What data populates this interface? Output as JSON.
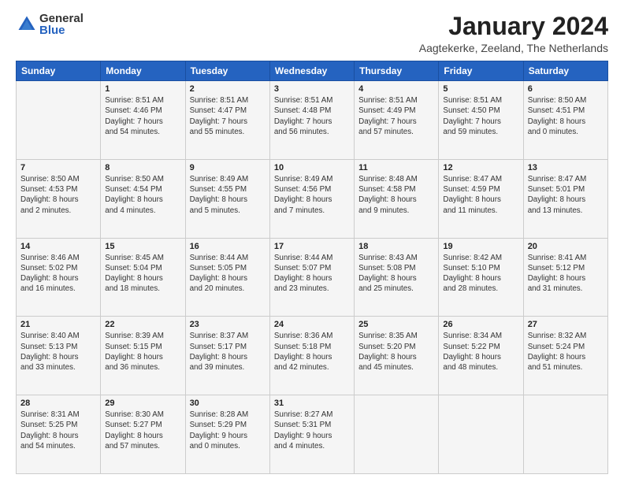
{
  "logo": {
    "general": "General",
    "blue": "Blue"
  },
  "title": "January 2024",
  "location": "Aagtekerke, Zeeland, The Netherlands",
  "weekdays": [
    "Sunday",
    "Monday",
    "Tuesday",
    "Wednesday",
    "Thursday",
    "Friday",
    "Saturday"
  ],
  "weeks": [
    [
      {
        "day": "",
        "info": ""
      },
      {
        "day": "1",
        "info": "Sunrise: 8:51 AM\nSunset: 4:46 PM\nDaylight: 7 hours\nand 54 minutes."
      },
      {
        "day": "2",
        "info": "Sunrise: 8:51 AM\nSunset: 4:47 PM\nDaylight: 7 hours\nand 55 minutes."
      },
      {
        "day": "3",
        "info": "Sunrise: 8:51 AM\nSunset: 4:48 PM\nDaylight: 7 hours\nand 56 minutes."
      },
      {
        "day": "4",
        "info": "Sunrise: 8:51 AM\nSunset: 4:49 PM\nDaylight: 7 hours\nand 57 minutes."
      },
      {
        "day": "5",
        "info": "Sunrise: 8:51 AM\nSunset: 4:50 PM\nDaylight: 7 hours\nand 59 minutes."
      },
      {
        "day": "6",
        "info": "Sunrise: 8:50 AM\nSunset: 4:51 PM\nDaylight: 8 hours\nand 0 minutes."
      }
    ],
    [
      {
        "day": "7",
        "info": "Sunrise: 8:50 AM\nSunset: 4:53 PM\nDaylight: 8 hours\nand 2 minutes."
      },
      {
        "day": "8",
        "info": "Sunrise: 8:50 AM\nSunset: 4:54 PM\nDaylight: 8 hours\nand 4 minutes."
      },
      {
        "day": "9",
        "info": "Sunrise: 8:49 AM\nSunset: 4:55 PM\nDaylight: 8 hours\nand 5 minutes."
      },
      {
        "day": "10",
        "info": "Sunrise: 8:49 AM\nSunset: 4:56 PM\nDaylight: 8 hours\nand 7 minutes."
      },
      {
        "day": "11",
        "info": "Sunrise: 8:48 AM\nSunset: 4:58 PM\nDaylight: 8 hours\nand 9 minutes."
      },
      {
        "day": "12",
        "info": "Sunrise: 8:47 AM\nSunset: 4:59 PM\nDaylight: 8 hours\nand 11 minutes."
      },
      {
        "day": "13",
        "info": "Sunrise: 8:47 AM\nSunset: 5:01 PM\nDaylight: 8 hours\nand 13 minutes."
      }
    ],
    [
      {
        "day": "14",
        "info": "Sunrise: 8:46 AM\nSunset: 5:02 PM\nDaylight: 8 hours\nand 16 minutes."
      },
      {
        "day": "15",
        "info": "Sunrise: 8:45 AM\nSunset: 5:04 PM\nDaylight: 8 hours\nand 18 minutes."
      },
      {
        "day": "16",
        "info": "Sunrise: 8:44 AM\nSunset: 5:05 PM\nDaylight: 8 hours\nand 20 minutes."
      },
      {
        "day": "17",
        "info": "Sunrise: 8:44 AM\nSunset: 5:07 PM\nDaylight: 8 hours\nand 23 minutes."
      },
      {
        "day": "18",
        "info": "Sunrise: 8:43 AM\nSunset: 5:08 PM\nDaylight: 8 hours\nand 25 minutes."
      },
      {
        "day": "19",
        "info": "Sunrise: 8:42 AM\nSunset: 5:10 PM\nDaylight: 8 hours\nand 28 minutes."
      },
      {
        "day": "20",
        "info": "Sunrise: 8:41 AM\nSunset: 5:12 PM\nDaylight: 8 hours\nand 31 minutes."
      }
    ],
    [
      {
        "day": "21",
        "info": "Sunrise: 8:40 AM\nSunset: 5:13 PM\nDaylight: 8 hours\nand 33 minutes."
      },
      {
        "day": "22",
        "info": "Sunrise: 8:39 AM\nSunset: 5:15 PM\nDaylight: 8 hours\nand 36 minutes."
      },
      {
        "day": "23",
        "info": "Sunrise: 8:37 AM\nSunset: 5:17 PM\nDaylight: 8 hours\nand 39 minutes."
      },
      {
        "day": "24",
        "info": "Sunrise: 8:36 AM\nSunset: 5:18 PM\nDaylight: 8 hours\nand 42 minutes."
      },
      {
        "day": "25",
        "info": "Sunrise: 8:35 AM\nSunset: 5:20 PM\nDaylight: 8 hours\nand 45 minutes."
      },
      {
        "day": "26",
        "info": "Sunrise: 8:34 AM\nSunset: 5:22 PM\nDaylight: 8 hours\nand 48 minutes."
      },
      {
        "day": "27",
        "info": "Sunrise: 8:32 AM\nSunset: 5:24 PM\nDaylight: 8 hours\nand 51 minutes."
      }
    ],
    [
      {
        "day": "28",
        "info": "Sunrise: 8:31 AM\nSunset: 5:25 PM\nDaylight: 8 hours\nand 54 minutes."
      },
      {
        "day": "29",
        "info": "Sunrise: 8:30 AM\nSunset: 5:27 PM\nDaylight: 8 hours\nand 57 minutes."
      },
      {
        "day": "30",
        "info": "Sunrise: 8:28 AM\nSunset: 5:29 PM\nDaylight: 9 hours\nand 0 minutes."
      },
      {
        "day": "31",
        "info": "Sunrise: 8:27 AM\nSunset: 5:31 PM\nDaylight: 9 hours\nand 4 minutes."
      },
      {
        "day": "",
        "info": ""
      },
      {
        "day": "",
        "info": ""
      },
      {
        "day": "",
        "info": ""
      }
    ]
  ]
}
